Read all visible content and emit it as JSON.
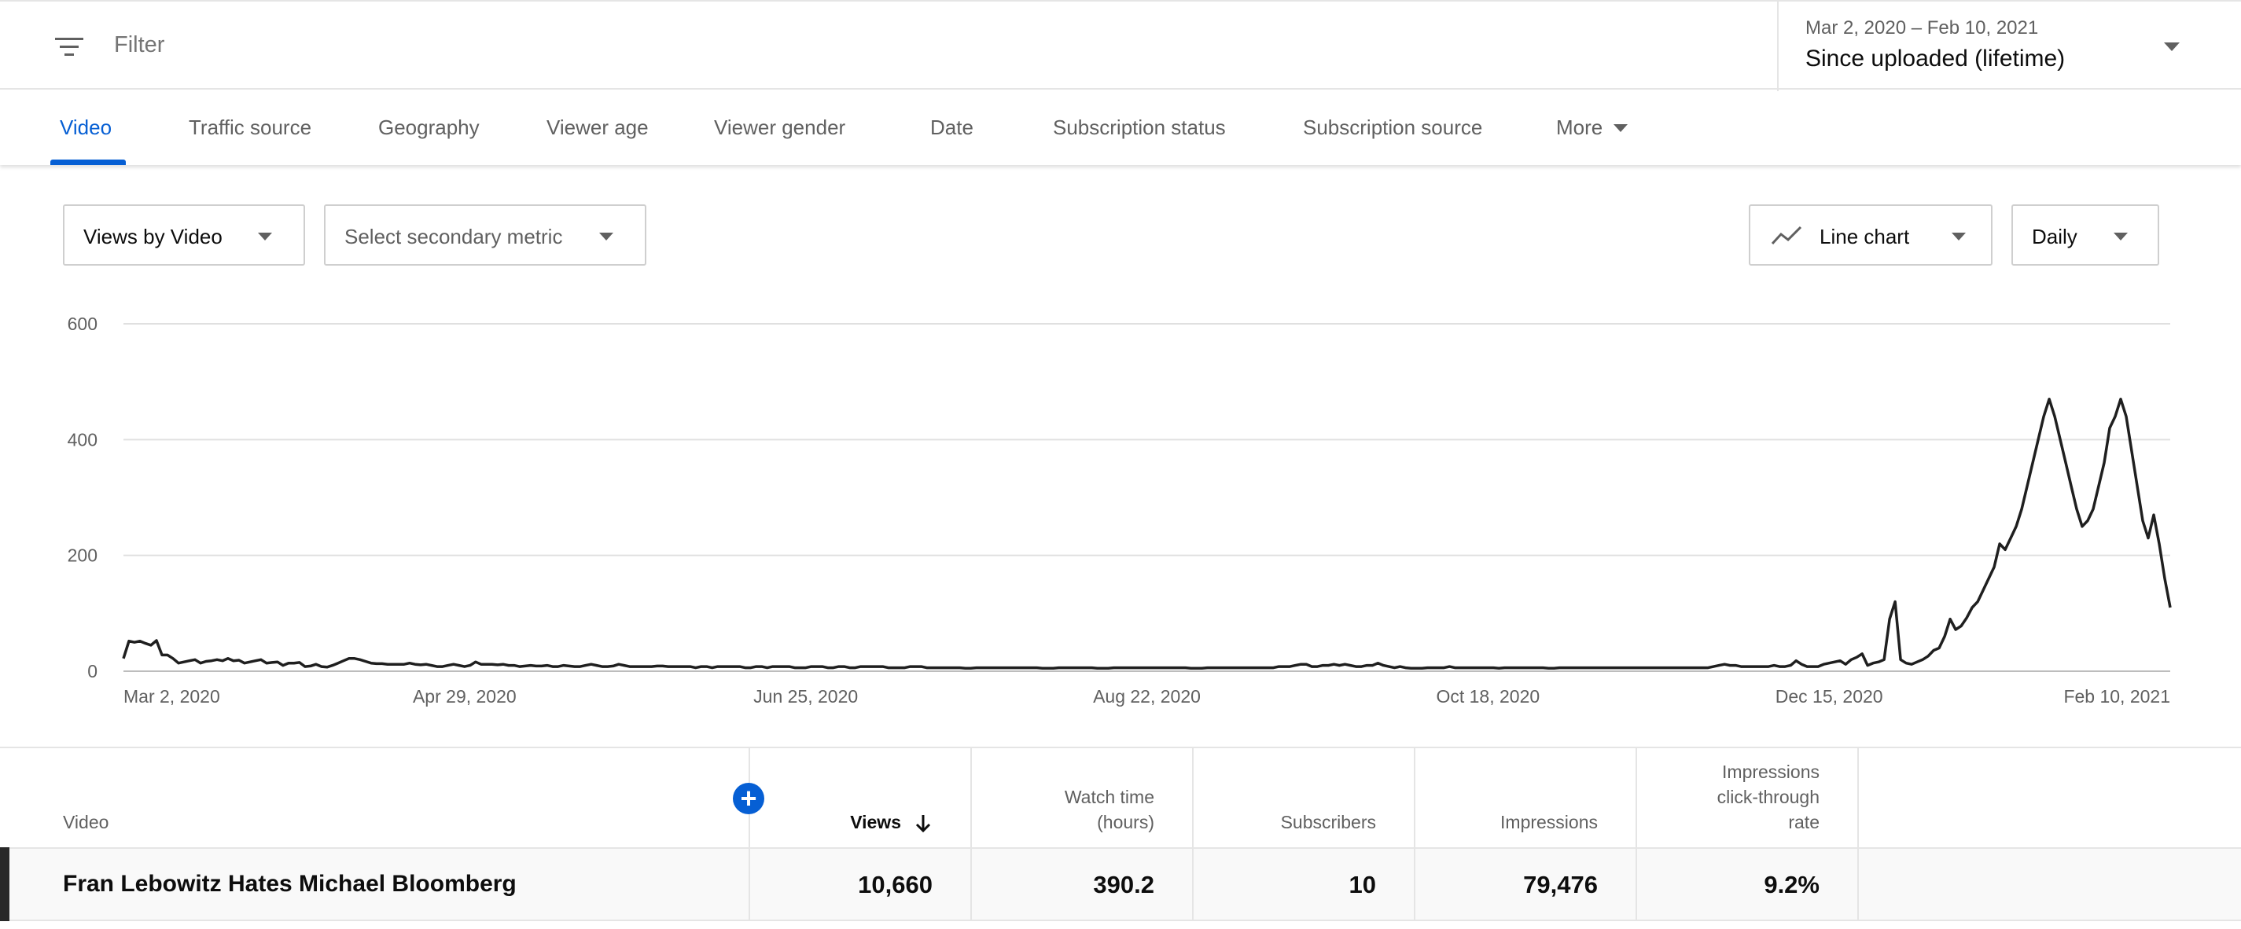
{
  "filter": {
    "placeholder": "Filter",
    "icon": "filter-icon"
  },
  "date_picker": {
    "range": "Mar 2, 2020 – Feb 10, 2021",
    "label": "Since uploaded (lifetime)"
  },
  "tabs": [
    {
      "label": "Video",
      "active": true
    },
    {
      "label": "Traffic source"
    },
    {
      "label": "Geography"
    },
    {
      "label": "Viewer age"
    },
    {
      "label": "Viewer gender"
    },
    {
      "label": "Date"
    },
    {
      "label": "Subscription status"
    },
    {
      "label": "Subscription source"
    },
    {
      "label": "More"
    }
  ],
  "controls": {
    "primary_metric": "Views by Video",
    "secondary_metric": "Select secondary metric",
    "chart_type": "Line chart",
    "interval": "Daily"
  },
  "chart_data": {
    "type": "line",
    "title": "",
    "xlabel": "",
    "ylabel": "",
    "ylim": [
      0,
      600
    ],
    "yticks": [
      "0",
      "200",
      "400",
      "600"
    ],
    "xticks": [
      "Mar 2, 2020",
      "Apr 29, 2020",
      "Jun 25, 2020",
      "Aug 22, 2020",
      "Oct 18, 2020",
      "Dec 15, 2020",
      "Feb 10, 2021"
    ],
    "x_start": "Mar 2, 2020",
    "x_end": "Feb 10, 2021",
    "grid": true,
    "series": [
      {
        "values": [
          22,
          52,
          50,
          52,
          48,
          45,
          53,
          28,
          28,
          22,
          14,
          16,
          18,
          20,
          14,
          17,
          18,
          20,
          18,
          22,
          18,
          19,
          14,
          16,
          18,
          20,
          14,
          15,
          16,
          10,
          14,
          14,
          15,
          8,
          9,
          12,
          8,
          7,
          10,
          14,
          18,
          22,
          22,
          20,
          17,
          14,
          13,
          13,
          12,
          12,
          12,
          12,
          14,
          12,
          11,
          12,
          10,
          8,
          8,
          10,
          12,
          10,
          8,
          10,
          16,
          12,
          12,
          12,
          11,
          12,
          10,
          10,
          8,
          9,
          10,
          9,
          9,
          10,
          8,
          8,
          10,
          9,
          8,
          8,
          10,
          12,
          10,
          8,
          8,
          9,
          12,
          10,
          8,
          8,
          8,
          8,
          8,
          9,
          9,
          8,
          8,
          8,
          8,
          8,
          6,
          8,
          8,
          6,
          8,
          8,
          8,
          8,
          8,
          6,
          6,
          8,
          8,
          6,
          8,
          8,
          8,
          8,
          6,
          6,
          6,
          8,
          8,
          8,
          6,
          6,
          8,
          8,
          6,
          6,
          8,
          8,
          8,
          8,
          8,
          6,
          6,
          6,
          6,
          8,
          8,
          8,
          6,
          6,
          6,
          6,
          6,
          6,
          6,
          5,
          5,
          6,
          6,
          6,
          6,
          6,
          6,
          6,
          6,
          6,
          6,
          6,
          6,
          5,
          5,
          5,
          6,
          6,
          6,
          6,
          6,
          6,
          6,
          5,
          5,
          5,
          6,
          6,
          6,
          6,
          6,
          6,
          6,
          6,
          6,
          6,
          6,
          6,
          6,
          6,
          5,
          5,
          5,
          6,
          6,
          6,
          6,
          6,
          6,
          6,
          6,
          6,
          6,
          6,
          6,
          6,
          8,
          8,
          8,
          10,
          12,
          12,
          8,
          8,
          10,
          10,
          12,
          10,
          12,
          10,
          8,
          8,
          10,
          10,
          14,
          10,
          8,
          6,
          8,
          6,
          5,
          5,
          5,
          6,
          6,
          6,
          6,
          8,
          6,
          6,
          6,
          6,
          6,
          6,
          6,
          6,
          5,
          6,
          6,
          6,
          6,
          6,
          6,
          6,
          6,
          5,
          5,
          6,
          6,
          6,
          6,
          6,
          6,
          6,
          6,
          6,
          6,
          6,
          6,
          6,
          6,
          6,
          6,
          6,
          6,
          6,
          6,
          6,
          6,
          6,
          6,
          6,
          6,
          6,
          6,
          8,
          10,
          12,
          10,
          10,
          8,
          8,
          8,
          8,
          8,
          8,
          10,
          8,
          8,
          10,
          18,
          12,
          8,
          8,
          8,
          12,
          14,
          16,
          18,
          12,
          20,
          24,
          30,
          10,
          14,
          16,
          20,
          90,
          120,
          20,
          14,
          12,
          16,
          20,
          26,
          36,
          40,
          60,
          90,
          72,
          78,
          92,
          110,
          120,
          140,
          160,
          180,
          220,
          210,
          230,
          250,
          280,
          320,
          360,
          400,
          440,
          470,
          440,
          400,
          360,
          320,
          280,
          250,
          260,
          280,
          320,
          360,
          420,
          440,
          470,
          440,
          380,
          320,
          260,
          230,
          270,
          220,
          160,
          110
        ]
      }
    ]
  },
  "table": {
    "headers": {
      "video": "Video",
      "views": "Views",
      "watch_time_1": "Watch time",
      "watch_time_2": "(hours)",
      "subscribers": "Subscribers",
      "impressions": "Impressions",
      "ctr_1": "Impressions",
      "ctr_2": "click-through",
      "ctr_3": "rate"
    },
    "rows": [
      {
        "video": "Fran Lebowitz Hates Michael Bloomberg",
        "views": "10,660",
        "watch_time": "390.2",
        "subscribers": "10",
        "impressions": "79,476",
        "ctr": "9.2%"
      }
    ]
  },
  "colors": {
    "accent": "#065fd4",
    "line": "#1f1f1f",
    "grid": "#e0e0e0"
  }
}
